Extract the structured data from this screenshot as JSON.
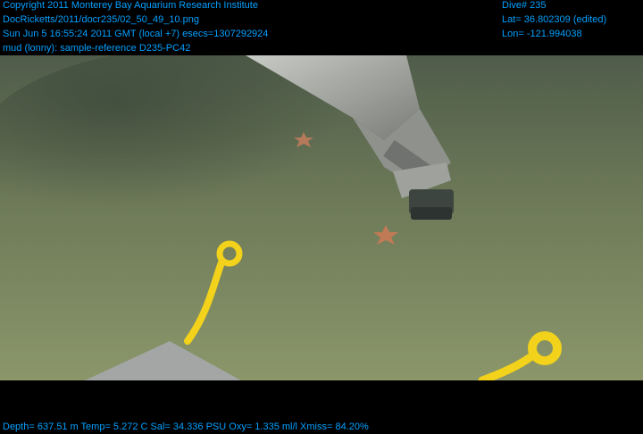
{
  "overlay": {
    "copyright": "Copyright 2011 Monterey Bay Aquarium Research Institute",
    "file_path": "DocRicketts/2011/docr235/02_50_49_10.png",
    "timestamp": "Sun Jun  5 16:55:24 2011 GMT (local +7)  esecs=1307292924",
    "annotation": "mud (lonny): sample-reference D235-PC42",
    "dive": "Dive# 235",
    "latitude": "Lat= 36.802309 (edited)",
    "longitude": "Lon= -121.994038",
    "telemetry": "Depth= 637.51 m  Temp= 5.272 C  Sal= 34.336 PSU  Oxy= 1.335 ml/l  Xmiss= 84.20%"
  },
  "colors": {
    "overlay_text": "#00a0ff",
    "seafloor": "#7d8a5c",
    "rope": "#f2d21a",
    "arm": "#a8aaa6"
  }
}
